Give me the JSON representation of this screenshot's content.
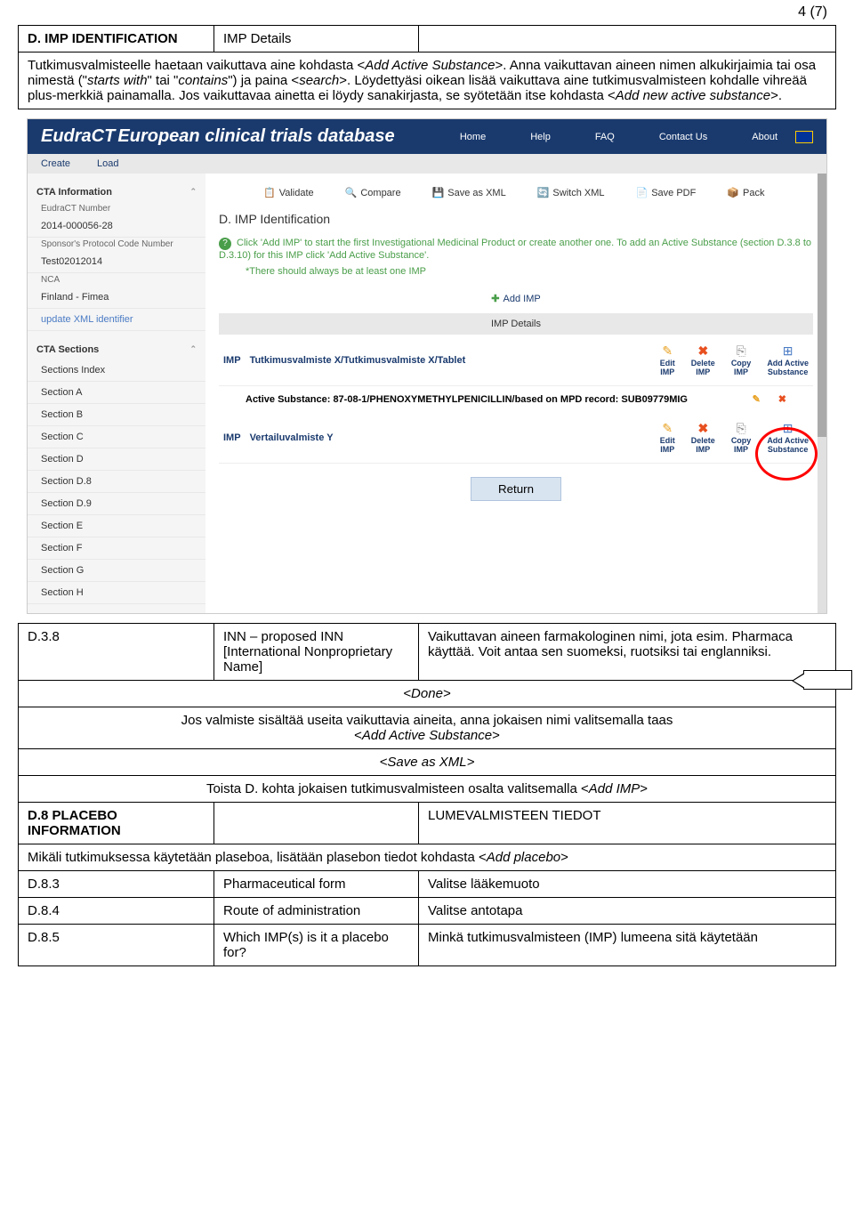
{
  "page_number": "4 (7)",
  "doc": {
    "d_imp_title": "D. IMP IDENTIFICATION",
    "d_imp_col2": "IMP Details",
    "d_imp_text": "Tutkimusvalmisteelle haetaan vaikuttava aine kohdasta <Add Active Substance>. Anna vaikuttavan aineen nimen alkukirjaimia tai osa nimestä (\"starts with\" tai \"contains\") ja paina <search>. Löydettyäsi oikean lisää vaikuttava aine tutkimusvalmisteen kohdalle vihreää plus-merkkiä painamalla. Jos vaikuttavaa ainetta ei löydy sanakirjasta, se syötetään itse kohdasta <Add new active substance>.",
    "d38_code": "D.3.8",
    "d38_mid": "INN – proposed INN [International Nonproprietary Name]",
    "d38_right": "Vaikuttavan aineen farmakologinen nimi, jota esim. Pharmaca käyttää. Voit antaa sen suomeksi, ruotsiksi tai englanniksi.",
    "done": "<Done>",
    "multi_substance": "Jos valmiste sisältää useita vaikuttavia aineita, anna jokaisen nimi valitsemalla taas <Add Active Substance>",
    "save_xml": "<Save as XML>",
    "repeat_d": "Toista D. kohta jokaisen tutkimusvalmisteen osalta valitsemalla <Add IMP>",
    "d8_title": "D.8 PLACEBO INFORMATION",
    "d8_right": "LUMEVALMISTEEN TIEDOT",
    "d8_text": "Mikäli tutkimuksessa käytetään plaseboa, lisätään plasebon tiedot kohdasta <Add placebo>",
    "d83_code": "D.8.3",
    "d83_mid": "Pharmaceutical form",
    "d83_right": "Valitse lääkemuoto",
    "d84_code": "D.8.4",
    "d84_mid": "Route of administration",
    "d84_right": "Valitse antotapa",
    "d85_code": "D.8.5",
    "d85_mid": "Which IMP(s) is it a placebo for?",
    "d85_right": "Minkä tutkimusvalmisteen (IMP) lumeena sitä käytetään"
  },
  "shot": {
    "logo": "EudraCT",
    "logo_sub": "European clinical trials database",
    "nav": {
      "home": "Home",
      "help": "Help",
      "faq": "FAQ",
      "contact": "Contact Us",
      "about": "About"
    },
    "subnav": {
      "create": "Create",
      "load": "Load"
    },
    "sidebar": {
      "cta_title": "CTA Information",
      "eudract_label": "EudraCT Number",
      "eudract_value": "2014-000056-28",
      "sponsor_label": "Sponsor's Protocol Code Number",
      "sponsor_value": "Test02012014",
      "nca_label": "NCA",
      "nca_value": "Finland - Fimea",
      "update_xml": "update XML identifier",
      "sections_title": "CTA Sections",
      "sections": [
        "Sections Index",
        "Section A",
        "Section B",
        "Section C",
        "Section D",
        "Section D.8",
        "Section D.9",
        "Section E",
        "Section F",
        "Section G",
        "Section H"
      ]
    },
    "toolbar": {
      "validate": "Validate",
      "compare": "Compare",
      "save_xml": "Save as XML",
      "switch_xml": "Switch XML",
      "save_pdf": "Save PDF",
      "pack": "Pack"
    },
    "main_title": "D. IMP Identification",
    "instruction": "Click 'Add IMP' to start the first Investigational Medicinal Product or create another one. To add an Active Substance (section D.3.8 to D.3.10) for this IMP click 'Add Active Substance'.",
    "instruction_note": "*There should always be at least one IMP",
    "add_imp": "Add IMP",
    "imp_details": "IMP Details",
    "imp_tag": "IMP",
    "imp1_name": "Tutkimusvalmiste X/Tutkimusvalmiste X/Tablet",
    "substance_label": "Active Substance:",
    "substance_value": "87-08-1/PHENOXYMETHYLPENICILLIN/based on MPD record: SUB09779MIG",
    "imp2_name": "Vertailuvalmiste Y",
    "actions": {
      "edit": "Edit",
      "delete": "Delete",
      "copy": "Copy",
      "add_active": "Add Active",
      "imp": "IMP",
      "substance": "Substance"
    },
    "return": "Return"
  }
}
